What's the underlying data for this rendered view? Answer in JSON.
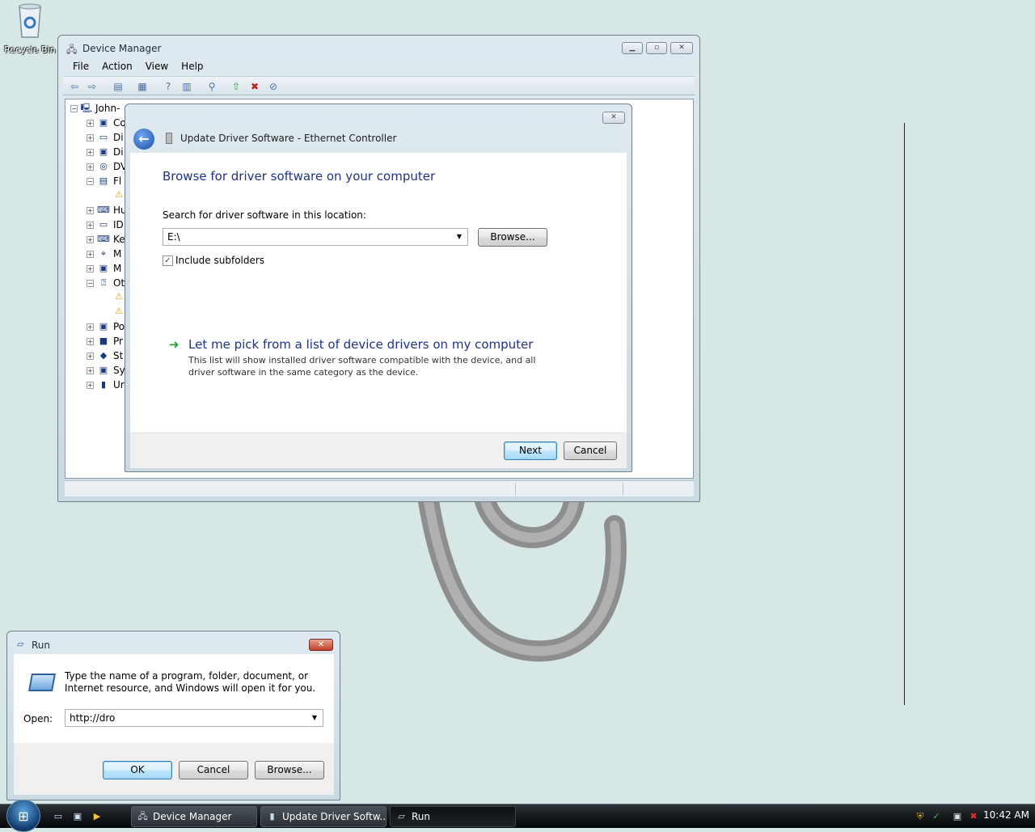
{
  "desktop": {
    "recycle_bin_label": "Recycle Bin"
  },
  "device_manager": {
    "title": "Device Manager",
    "menu": [
      "File",
      "Action",
      "View",
      "Help"
    ],
    "tree_root": "John-",
    "tree_items": [
      "Co",
      "Di",
      "Di",
      "DV",
      "Fl",
      "Hu",
      "ID",
      "Ke",
      "M",
      "M",
      "Ot",
      "Po",
      "Pr",
      "St",
      "Sy",
      "Ur"
    ]
  },
  "update_driver": {
    "title": "Update Driver Software - Ethernet Controller",
    "heading": "Browse for driver software on your computer",
    "search_label": "Search for driver software in this location:",
    "location_value": "E:\\",
    "browse_label": "Browse...",
    "include_subfolders_label": "Include subfolders",
    "include_subfolders_checked": true,
    "pick_title": "Let me pick from a list of device drivers on my computer",
    "pick_desc": "This list will show installed driver software compatible with the device, and all driver software in the same category as the device.",
    "next_label": "Next",
    "cancel_label": "Cancel"
  },
  "run_dialog": {
    "title": "Run",
    "description": "Type the name of a program, folder, document, or Internet resource, and Windows will open it for you.",
    "open_label": "Open:",
    "open_value": "http://dro",
    "ok_label": "OK",
    "cancel_label": "Cancel",
    "browse_label": "Browse..."
  },
  "taskbar": {
    "tasks": [
      "Device Manager",
      "Update Driver Softw...",
      "Run"
    ],
    "clock": "10:42 AM"
  },
  "colors": {
    "desktop_bg": "#d6e7e6",
    "heading_blue": "#1e3287",
    "link_arrow_green": "#1fa33a"
  }
}
